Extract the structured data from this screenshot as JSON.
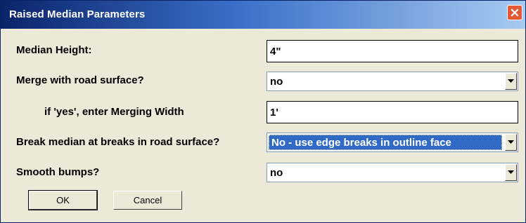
{
  "window": {
    "title": "Raised Median Parameters",
    "close_icon": "close-icon"
  },
  "fields": {
    "median_height": {
      "label": "Median Height:",
      "value": "4\""
    },
    "merge": {
      "label": "Merge with road surface?",
      "value": "no"
    },
    "merging_width": {
      "label": "if 'yes', enter Merging Width",
      "value": "1'"
    },
    "break_median": {
      "label": "Break median at breaks in road surface?",
      "value": "No - use edge breaks in outline face"
    },
    "smooth_bumps": {
      "label": "Smooth bumps?",
      "value": "no"
    }
  },
  "buttons": {
    "ok": "OK",
    "cancel": "Cancel"
  },
  "colors": {
    "title_start": "#0a246a",
    "title_end": "#a6caf0",
    "selection": "#316ac5",
    "close": "#e35a38",
    "dialog_bg": "#ece9d8"
  }
}
